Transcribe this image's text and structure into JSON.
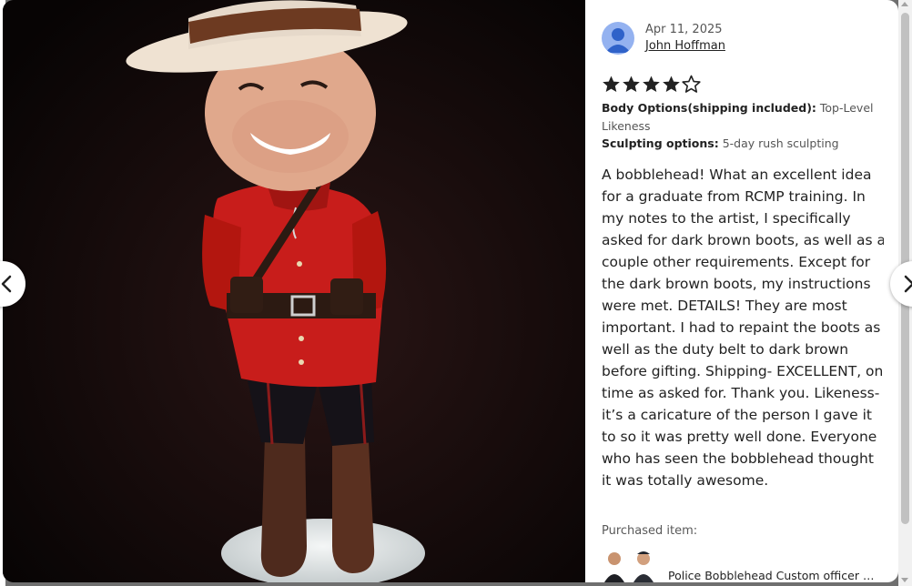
{
  "review": {
    "date": "Apr 11, 2025",
    "reviewer": "John Hoffman",
    "rating": 4,
    "rating_max": 5,
    "options": [
      {
        "label": "Body Options(shipping included):",
        "value": "Top-Level Likeness"
      },
      {
        "label": "Sculpting options:",
        "value": "5-day rush sculpting"
      }
    ],
    "text": "A bobblehead! What an excellent idea for a graduate from RCMP training. In my notes to the artist, I specifically asked for dark brown boots, as well as a couple other requirements. Except for the dark brown boots, my instructions were met. DETAILS! They are most important. I had to repaint the boots as well as the duty belt to dark brown before gifting. Shipping- EXCELLENT, on time as asked for. Thank you. Likeness- it’s a caricature of the person I gave it to so it was pretty well done. Everyone who has seen the bobblehead thought it was totally awesome.",
    "purchased_label": "Purchased item:",
    "purchased_item_title": "Police Bobblehead Custom officer Gift"
  },
  "navigation": {
    "prev_icon": "chevron-left-icon",
    "next_icon": "chevron-right-icon"
  },
  "colors": {
    "star": "#222222",
    "avatar": "#94b2f0",
    "photo_background": "#0b0707",
    "uniform_red": "#c81d1b"
  }
}
